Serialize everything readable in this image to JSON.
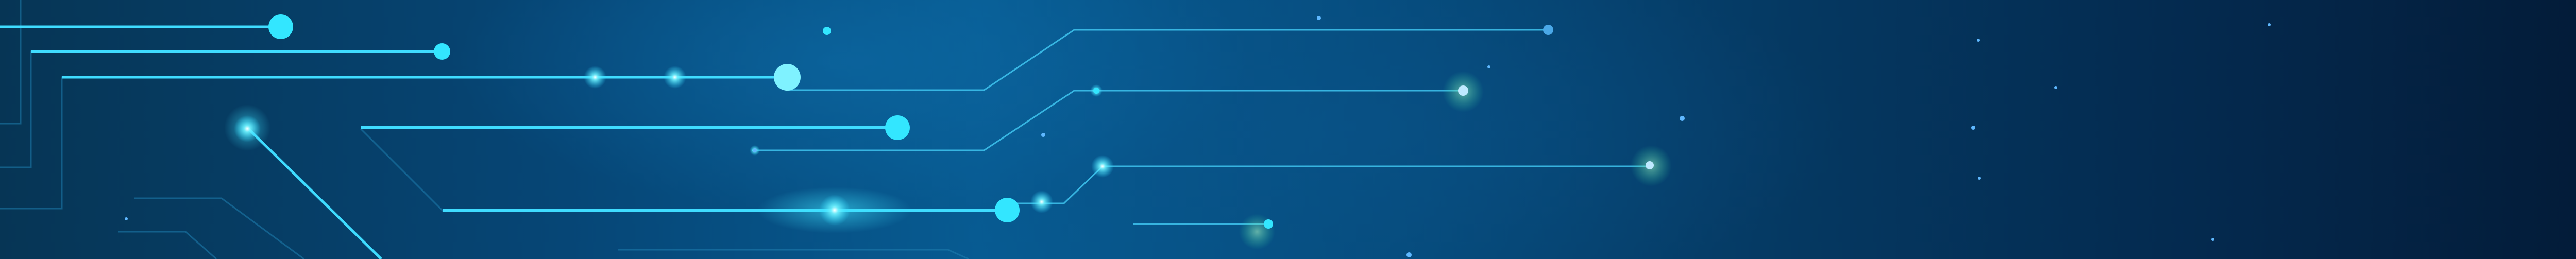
{
  "scene": {
    "subject": "circuit-board",
    "colors": {
      "background_left": "#064676",
      "background_mid": "#075b92",
      "background_right": "#031c39",
      "trace": "#3fdcff",
      "trace_dim": "#2aa9d8",
      "node": "#33e6ff",
      "node_pale": "#bfe9ff",
      "glow": "#6ff2ff",
      "star": "#5fb8ff"
    }
  }
}
